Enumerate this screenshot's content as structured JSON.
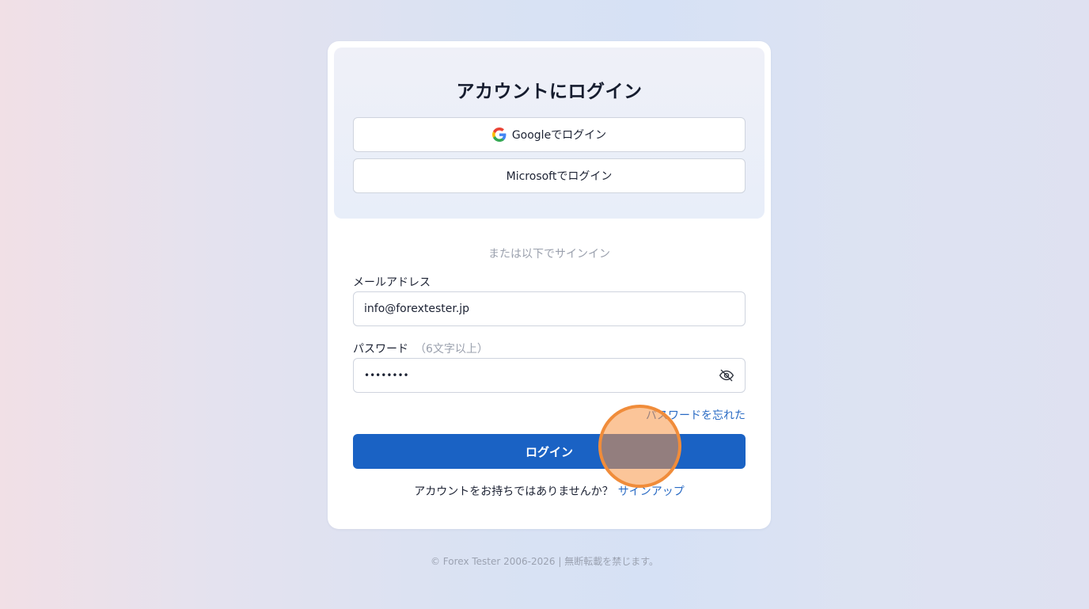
{
  "login": {
    "title": "アカウントにログイン",
    "google_button": "Googleでログイン",
    "microsoft_button": "Microsoftでログイン",
    "divider": "または以下でサインイン",
    "email_label": "メールアドレス",
    "email_value": "info@forextester.jp",
    "password_label": "パスワード",
    "password_hint": "（6文字以上）",
    "password_value": "••••••••",
    "forgot_link": "パスワードを忘れた",
    "submit": "ログイン",
    "no_account": "アカウントをお持ちではありませんか？",
    "signup_link": "サインアップ"
  },
  "footer": {
    "copyright": "© Forex Tester 2006-2026 | 無断転載を禁じます。"
  },
  "icons": {
    "google": "google-icon",
    "microsoft": "microsoft-icon",
    "eye_hidden": "eye-off-icon"
  },
  "colors": {
    "primary": "#1a62c4",
    "link": "#2a6bc4",
    "click_marker": "#f08c3a",
    "ms_red": "#f25022",
    "ms_green": "#7fba00",
    "ms_blue": "#00a4ef",
    "ms_yellow": "#ffb900"
  }
}
